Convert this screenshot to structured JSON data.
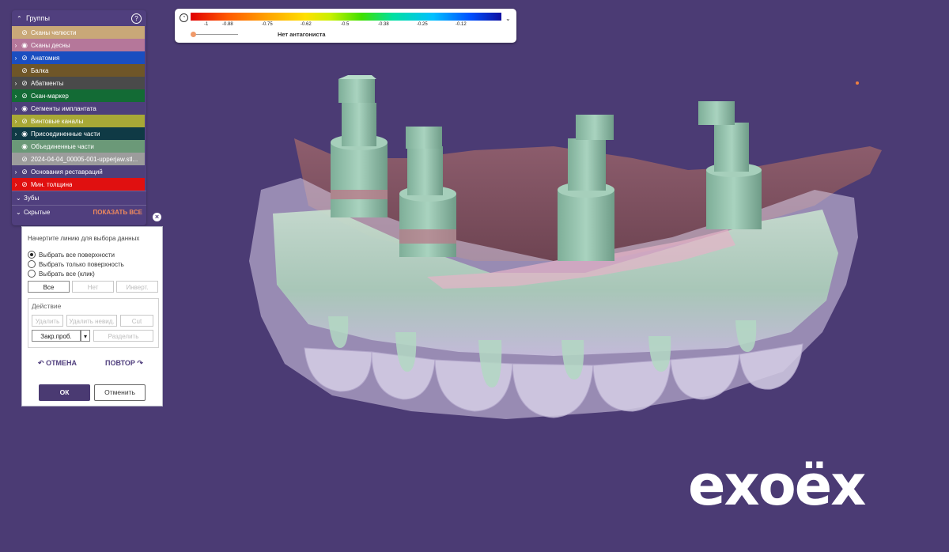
{
  "groups_panel": {
    "title": "Группы",
    "help_icon": "question-circle-icon",
    "items": [
      {
        "label": "Сканы челюсти",
        "color": "#c9a878",
        "expand": false,
        "eye": "eye-hidden"
      },
      {
        "label": "Сканы десны",
        "color": "#b5779a",
        "expand": true,
        "eye": "eye"
      },
      {
        "label": "Анатомия",
        "color": "#1a4ec0",
        "expand": true,
        "eye": "eye-hidden"
      },
      {
        "label": "Балка",
        "color": "#6f5628",
        "expand": false,
        "eye": "eye-hidden"
      },
      {
        "label": "Абатменты",
        "color": "#4a4a4a",
        "expand": true,
        "eye": "eye-hidden"
      },
      {
        "label": "Скан-маркер",
        "color": "#136b35",
        "expand": true,
        "eye": "eye-hidden"
      },
      {
        "label": "Сегменты имплантата",
        "color": "#4d3f7a",
        "expand": true,
        "eye": "eye"
      },
      {
        "label": "Винтовые каналы",
        "color": "#a8a836",
        "expand": true,
        "eye": "eye-hidden"
      },
      {
        "label": "Присоединенные части",
        "color": "#0f3a45",
        "expand": true,
        "eye": "eye"
      },
      {
        "label": "Объединенные части",
        "color": "#6b9978",
        "expand": false,
        "eye": "eye"
      },
      {
        "label": "2024-04-04_00005-001-upperjaw.stl...",
        "color": "#9c9c9c",
        "expand": false,
        "eye": "eye-hidden"
      },
      {
        "label": "Основания реставраций",
        "color": "#4d3f7a",
        "expand": true,
        "eye": "eye-hidden"
      },
      {
        "label": "Мин. толщина",
        "color": "#e01010",
        "expand": true,
        "eye": "eye-hidden"
      }
    ],
    "teeth_label": "Зубы",
    "hidden_label": "Скрытые",
    "show_all_label": "ПОКАЗАТЬ ВСЕ"
  },
  "dialog": {
    "instruction": "Начертите линию для выбора данных",
    "radio_options": [
      {
        "label": "Выбрать все поверхности",
        "selected": true
      },
      {
        "label": "Выбрать только поверхность",
        "selected": false
      },
      {
        "label": "Выбрать все (клик)",
        "selected": false
      }
    ],
    "select_all": "Все",
    "select_none": "Нет",
    "invert": "Инверт.",
    "action_title": "Действие",
    "delete": "Удалить",
    "delete_unused": "Удалить невид.",
    "cut": "Cut",
    "close_holes": "Закр.проб.",
    "split": "Разделить",
    "undo": "ОТМЕНА",
    "redo": "ПОВТОР",
    "ok": "ОК",
    "cancel": "Отменить"
  },
  "scale": {
    "ticks": [
      "-1",
      "-0.88",
      "-0.75",
      "-0.62",
      "-0.5",
      "-0.38",
      "-0.25",
      "-0.12"
    ],
    "no_antagonist": "Нет антагониста",
    "colors": [
      "#e00000",
      "#ffa500",
      "#ffe000",
      "#3fe000",
      "#00e0a0",
      "#00c0ff",
      "#1010a0"
    ]
  },
  "viewport": {
    "background": "#4b3b74",
    "object": "dental bridge model with implants"
  },
  "logo": {
    "text": "exoëx"
  }
}
